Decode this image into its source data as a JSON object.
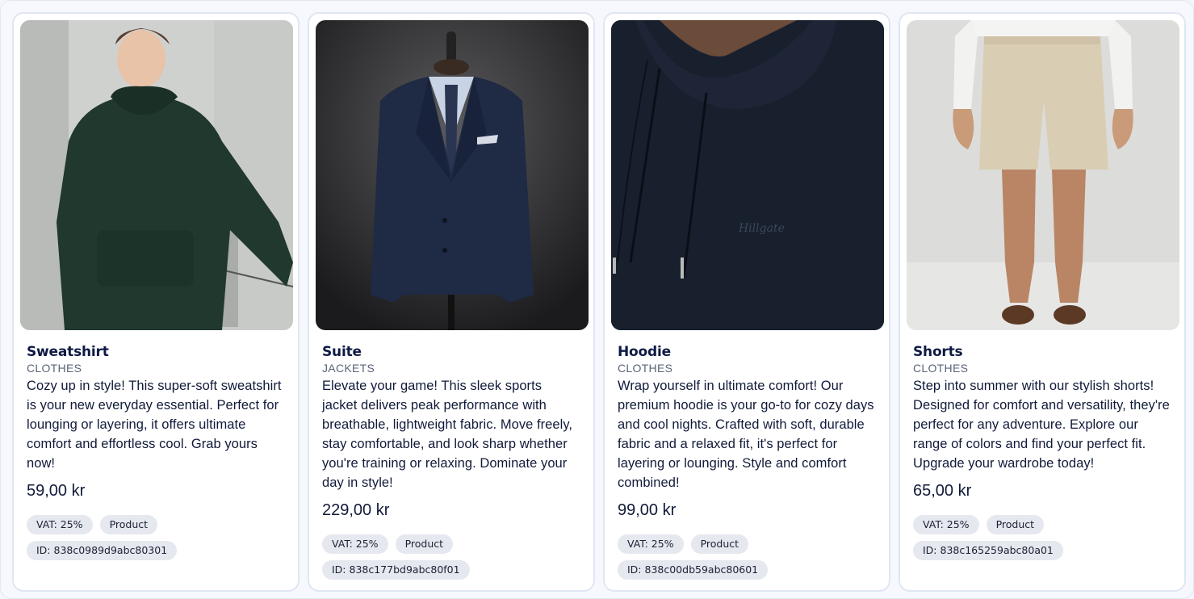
{
  "products": [
    {
      "name": "Sweatshirt",
      "category": "CLOTHES",
      "description": "Cozy up in style! This super-soft sweatshirt is your new everyday essential. Perfect for lounging or layering, it offers ultimate comfort and effortless cool. Grab yours now!",
      "price": "59,00 kr",
      "vat": "VAT: 25%",
      "type": "Product",
      "id": "ID: 838c0989d9abc80301"
    },
    {
      "name": "Suite",
      "category": "JACKETS",
      "description": "Elevate your game! This sleek sports jacket delivers peak performance with breathable, lightweight fabric. Move freely, stay comfortable, and look sharp whether you're training or relaxing. Dominate your day in style!",
      "price": "229,00 kr",
      "vat": "VAT: 25%",
      "type": "Product",
      "id": "ID: 838c177bd9abc80f01"
    },
    {
      "name": "Hoodie",
      "category": "CLOTHES",
      "description": "Wrap yourself in ultimate comfort! Our premium hoodie is your go-to for cozy days and cool nights. Crafted with soft, durable fabric and a relaxed fit, it's perfect for layering or lounging. Style and comfort combined!",
      "price": "99,00 kr",
      "vat": "VAT: 25%",
      "type": "Product",
      "id": "ID: 838c00db59abc80601"
    },
    {
      "name": "Shorts",
      "category": "CLOTHES",
      "description": "Step into summer with our stylish shorts! Designed for comfort and versatility, they're perfect for any adventure. Explore our range of colors and find your perfect fit. Upgrade your wardrobe today!",
      "price": "65,00 kr",
      "vat": "VAT: 25%",
      "type": "Product",
      "id": "ID: 838c165259abc80a01"
    }
  ],
  "colors": {
    "title": "#0e1a45",
    "category": "#5b6478",
    "tag_bg": "#e6e8ef",
    "card_border": "#dfe6f3"
  }
}
